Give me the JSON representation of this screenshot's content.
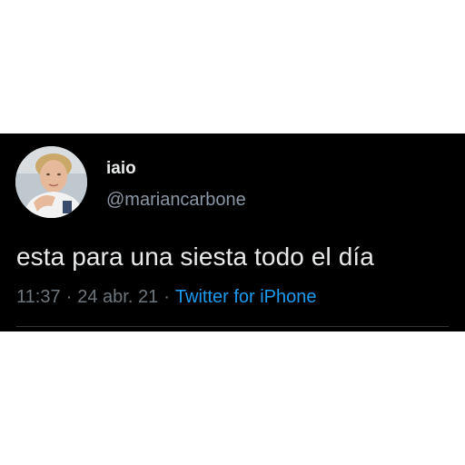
{
  "tweet": {
    "display_name": "iaio",
    "handle": "@mariancarbone",
    "text": "esta para una siesta todo el día",
    "time": "11:37",
    "separator": "·",
    "date": "24 abr. 21",
    "source": "Twitter for iPhone",
    "avatar_icon": "profile-photo-avatar"
  },
  "colors": {
    "card_background": "#000000",
    "page_background": "#ffffff",
    "primary_text": "#e7e9ea",
    "secondary_text": "#8b98a5",
    "link": "#1d9bf0"
  }
}
